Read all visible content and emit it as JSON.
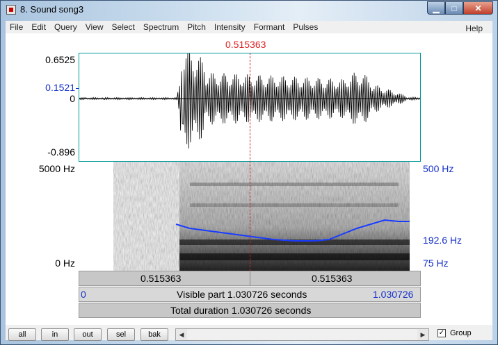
{
  "window": {
    "title": "8. Sound song3",
    "buttons": {
      "minimize": "▁",
      "maximize": "□",
      "close": "✕"
    }
  },
  "menu": [
    "File",
    "Edit",
    "Query",
    "View",
    "Select",
    "Spectrum",
    "Pitch",
    "Intensity",
    "Formant",
    "Pulses"
  ],
  "menu_help": "Help",
  "cursor_time": "0.515363",
  "waveform": {
    "ymax": "0.6525",
    "ymark": "0.1521",
    "yzero": "0",
    "ymin": "-0.896"
  },
  "spectrogram": {
    "freq_max": "5000 Hz",
    "freq_min": "0 Hz",
    "pitch_max": "500 Hz",
    "pitch_mark": "192.6 Hz",
    "pitch_min": "75 Hz",
    "pitch_color": "#1a3cff"
  },
  "info_bars": {
    "left_segment": "0.515363",
    "right_segment": "0.515363",
    "visible_start": "0",
    "visible_label": "Visible part 1.030726 seconds",
    "visible_end": "1.030726",
    "total_label": "Total duration 1.030726 seconds"
  },
  "footer": {
    "buttons": [
      "all",
      "in",
      "out",
      "sel",
      "bak"
    ],
    "group_label": "Group",
    "group_checked": "✓",
    "scroll_left": "◀",
    "scroll_right": "▶"
  },
  "colors": {
    "cursor": "#d22222",
    "frame_border": "#009999",
    "pitch_text": "#1530c8"
  }
}
